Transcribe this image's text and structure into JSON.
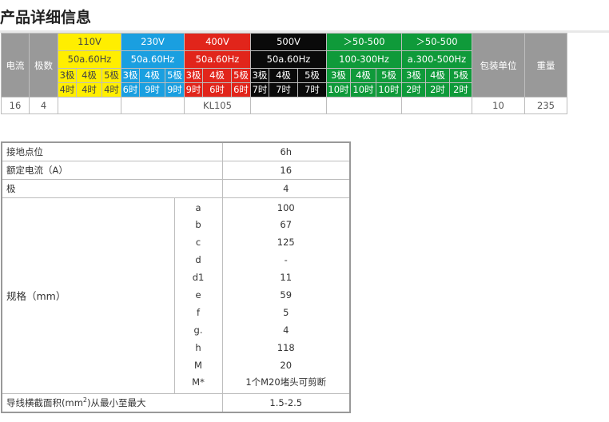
{
  "page": {
    "title": "产品详细信息"
  },
  "voltage_table": {
    "current_label": "电流",
    "poles_label": "极数",
    "packing_label": "包装单位",
    "weight_label": "重量",
    "groups": [
      {
        "voltage": "110V",
        "freq": "50a.60Hz",
        "color": "#ffee00",
        "poles": [
          "3极",
          "4极",
          "5极"
        ],
        "hours": [
          "4时",
          "4时",
          "4时"
        ]
      },
      {
        "voltage": "230V",
        "freq": "50a.60Hz",
        "color": "#1a9fe0",
        "poles": [
          "3极",
          "4极",
          "5极"
        ],
        "hours": [
          "6时",
          "9时",
          "9时"
        ]
      },
      {
        "voltage": "400V",
        "freq": "50a.60Hz",
        "color": "#e1251b",
        "poles": [
          "3极",
          "4极",
          "5极"
        ],
        "hours": [
          "9时",
          "6时",
          "6时"
        ]
      },
      {
        "voltage": "500V",
        "freq": "50a.60Hz",
        "color": "#0a0a0a",
        "poles": [
          "3极",
          "4极",
          "5极"
        ],
        "hours": [
          "7时",
          "7时",
          "7时"
        ]
      },
      {
        "voltage": "＞50-500",
        "freq": "100-300Hz",
        "color": "#0f9a3a",
        "poles": [
          "3极",
          "4极",
          "5极"
        ],
        "hours": [
          "10时",
          "10时",
          "10时"
        ]
      },
      {
        "voltage": "＞50-500",
        "freq": "a.300-500Hz",
        "color": "#0f9a3a",
        "poles": [
          "3极",
          "4极",
          "5极"
        ],
        "hours": [
          "2时",
          "2时",
          "2时"
        ]
      }
    ],
    "row": {
      "current": "16",
      "poles": "4",
      "model": "KL105",
      "packing": "10",
      "weight": "235"
    }
  },
  "spec_table": {
    "ground": {
      "label": "接地点位",
      "value": "6h"
    },
    "rated_current": {
      "label": "额定电流（A）",
      "value": "16"
    },
    "poles": {
      "label": "极",
      "value": "4"
    },
    "dimensions": {
      "label": "规格（mm）",
      "items": [
        {
          "key": "a",
          "value": "100"
        },
        {
          "key": "b",
          "value": "67"
        },
        {
          "key": "c",
          "value": "125"
        },
        {
          "key": "d",
          "value": "-"
        },
        {
          "key": "d1",
          "value": "11"
        },
        {
          "key": "e",
          "value": "59"
        },
        {
          "key": "f",
          "value": "5"
        },
        {
          "key": "g.",
          "value": "4"
        },
        {
          "key": "h",
          "value": "118"
        },
        {
          "key": "M",
          "value": "20"
        },
        {
          "key": "M*",
          "value": "1个M20堵头可剪断"
        }
      ]
    },
    "cross_section": {
      "label_pre": "导线横截面积(mm",
      "label_sup": "2",
      "label_post": ")从最小至最大",
      "value": "1.5-2.5"
    }
  }
}
